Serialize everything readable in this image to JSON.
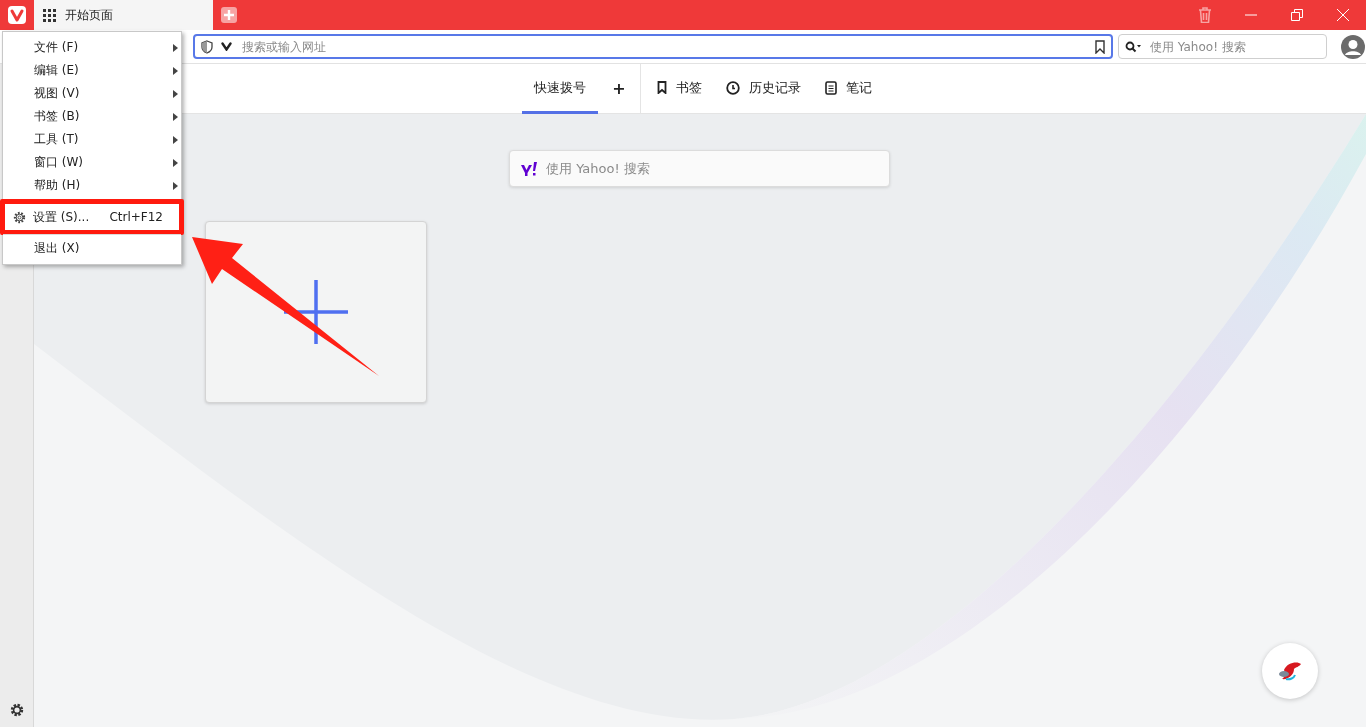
{
  "window": {
    "tab_title": "开始页面"
  },
  "address_bar": {
    "placeholder": "搜索或输入网址"
  },
  "search_field": {
    "placeholder": "使用 Yahoo! 搜索"
  },
  "start_tabs": [
    {
      "label": "快速拨号",
      "kind": "speed-dial",
      "selected": true
    },
    {
      "label": "书签",
      "kind": "bookmarks",
      "selected": false
    },
    {
      "label": "历史记录",
      "kind": "history",
      "selected": false
    },
    {
      "label": "笔记",
      "kind": "notes",
      "selected": false
    }
  ],
  "add_tab_label": "+",
  "page_search": {
    "placeholder": "使用 Yahoo! 搜索"
  },
  "menu": {
    "items": [
      {
        "label": "文件 (F)",
        "kind": "submenu"
      },
      {
        "label": "编辑 (E)",
        "kind": "submenu"
      },
      {
        "label": "视图 (V)",
        "kind": "submenu"
      },
      {
        "label": "书签 (B)",
        "kind": "submenu"
      },
      {
        "label": "工具 (T)",
        "kind": "submenu"
      },
      {
        "label": "窗口 (W)",
        "kind": "submenu"
      },
      {
        "label": "帮助 (H)",
        "kind": "submenu"
      },
      {
        "label": "设置 (S)...",
        "kind": "settings",
        "shortcut": "Ctrl+F12",
        "annotated": true
      },
      {
        "label": "退出 (X)",
        "kind": "plain",
        "annotated": false
      }
    ]
  }
}
